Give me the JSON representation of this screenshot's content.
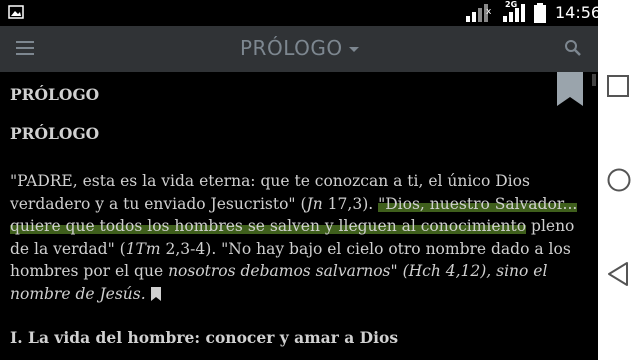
{
  "status_bar": {
    "time": "14:56",
    "network": "2G",
    "icons": [
      "image-notification-icon",
      "signal-icon",
      "signal-2g-icon",
      "battery-icon"
    ]
  },
  "app_bar": {
    "title": "PRÓLOGO",
    "background": "#303336",
    "title_color": "#7d8790",
    "icons": [
      "hamburger-menu-icon",
      "dropdown-caret-icon",
      "search-icon"
    ]
  },
  "content": {
    "heading_1": "PRÓLOGO",
    "heading_2": "PRÓLOGO",
    "paragraph": {
      "seg1": "\"PADRE, esta es la vida eterna: que te conozcan a ti, el único Dios verdadero y a tu enviado Jesucristo\" (",
      "seg2": "Jn",
      "seg3": " 17,3). ",
      "highlight": "\"Dios, nuestro Salvador... quiere que todos los hombres se salven y lleguen al conocimiento",
      "seg4": " pleno de la verdad\" (",
      "seg5": "1Tm",
      "seg6": " 2,3-4). \"No hay bajo el cielo otro nombre dado a los hombres por el que ",
      "seg7": "nosotros debamos salvarnos\" (Hch 4,12), sino el nombre de Jesús."
    },
    "section_heading": "I. La vida del hombre: conocer y amar a Dios",
    "highlight_color": "#3f5f1c",
    "text_color": "#d0d0d0"
  },
  "nav_bar": {
    "buttons": [
      "recent-apps-icon",
      "home-icon",
      "back-icon"
    ]
  }
}
